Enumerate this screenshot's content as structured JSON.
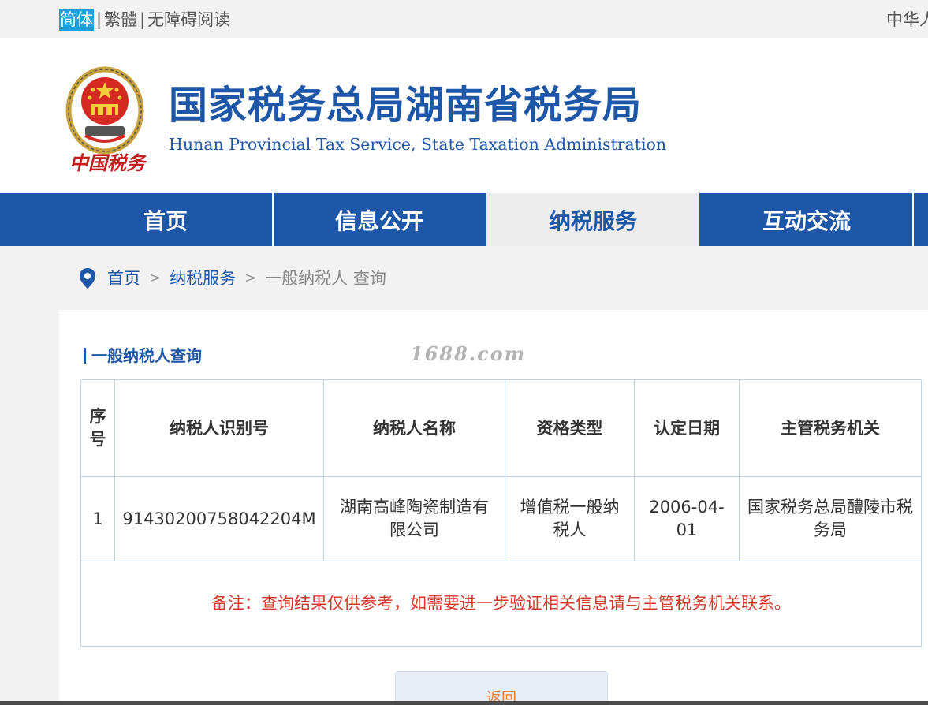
{
  "topbar": {
    "lang_simplified": "简体",
    "lang_traditional": "繁體",
    "accessibility": "无障碍阅读",
    "right_text": "中华人"
  },
  "header": {
    "title": "国家税务总局湖南省税务局",
    "subtitle": "Hunan Provincial  Tax Service,  State Taxation Administration",
    "emblem_caption": "中国税务"
  },
  "nav": {
    "items": [
      {
        "label": "首页"
      },
      {
        "label": "信息公开"
      },
      {
        "label": "纳税服务"
      },
      {
        "label": "互动交流"
      }
    ],
    "active_index": 2
  },
  "breadcrumb": {
    "home": "首页",
    "section": "纳税服务",
    "current": "一般纳税人 查询"
  },
  "section": {
    "title": "一般纳税人查询",
    "watermark": "1688.com"
  },
  "table": {
    "headers": [
      "序号",
      "纳税人识别号",
      "纳税人名称",
      "资格类型",
      "认定日期",
      "主管税务机关"
    ],
    "rows": [
      [
        "1",
        "91430200758042204M",
        "湖南高峰陶瓷制造有限公司",
        "增值税一般纳税人",
        "2006-04-01",
        "国家税务总局醴陵市税务局"
      ]
    ],
    "note": "备注：查询结果仅供参考，如需要进一步验证相关信息请与主管税务机关联系。"
  },
  "back_button": "返回",
  "colors": {
    "brand_blue": "#1e56a8",
    "nav_active_bg": "#ededed",
    "lang_active_bg": "#1aa1e1",
    "note_red": "#d4392b",
    "table_border": "#b9d2ea"
  }
}
